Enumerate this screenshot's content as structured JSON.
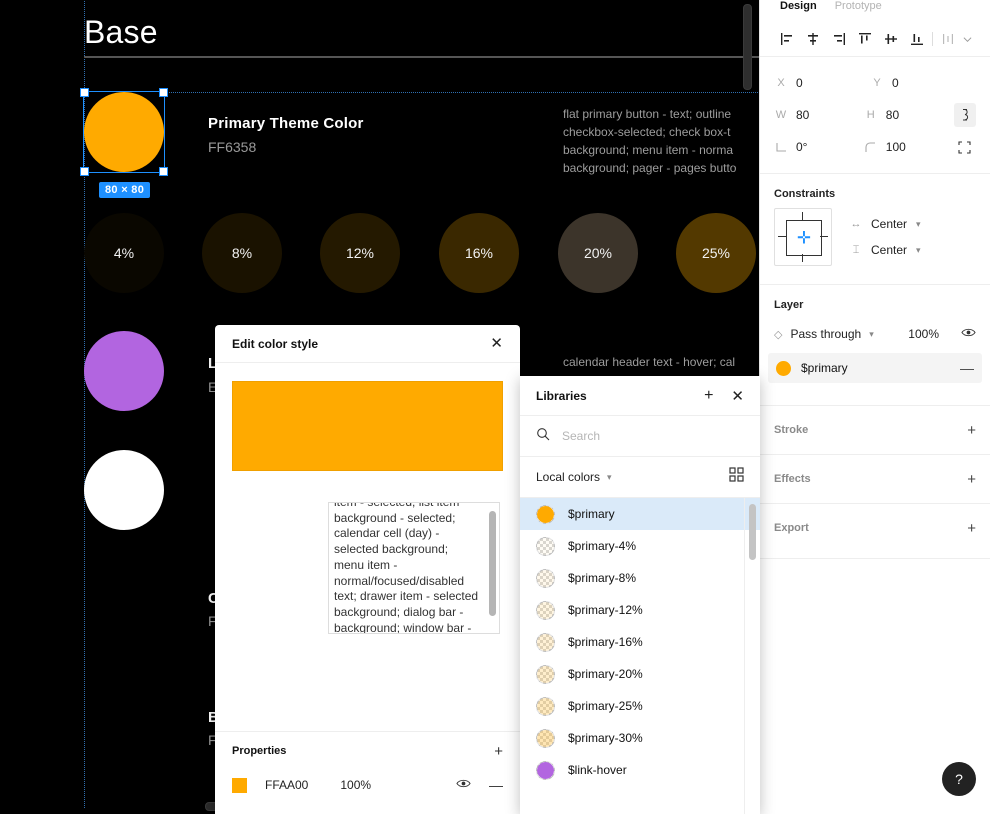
{
  "canvas": {
    "page_title": "Base",
    "selection_badge": "80 × 80",
    "primary": {
      "name": "Primary Theme Color",
      "hex": "FF6358",
      "description": "flat primary button - text; outline\ncheckbox-selected; check box-t\nbackground; menu item - norma\nbackground; pager - pages butto"
    },
    "tints": [
      {
        "label": "4%",
        "color": "#0a0700"
      },
      {
        "label": "8%",
        "color": "#1a1200"
      },
      {
        "label": "12%",
        "color": "#241900"
      },
      {
        "label": "16%",
        "color": "#3a2800"
      },
      {
        "label": "20%",
        "color": "#3c342a"
      },
      {
        "label": "25%",
        "color": "#533900"
      }
    ],
    "link_hover": {
      "color": "#b265e0",
      "title_initial": "L",
      "hex_initial": "E"
    },
    "white_swatch": {
      "color": "#ffffff",
      "title_initial": "C",
      "hex_initial": "F"
    },
    "bottom_group": {
      "title_initial": "B",
      "hex_initial": "F"
    },
    "calendar_note": "calendar header text - hover; cal"
  },
  "right_panel": {
    "tabs": [
      {
        "label": "Design",
        "active": true
      },
      {
        "label": "Prototype",
        "active": false
      }
    ],
    "align_icons": [
      "align-left-icon",
      "align-horizontal-center-icon",
      "align-right-icon",
      "align-top-icon",
      "align-vertical-center-icon",
      "align-bottom-icon",
      "distribute-icon"
    ],
    "transform": {
      "x_label": "X",
      "x_value": "0",
      "y_label": "Y",
      "y_value": "0",
      "w_label": "W",
      "w_value": "80",
      "h_label": "H",
      "h_value": "80",
      "rotation_label": "angle",
      "rotation_value": "0°",
      "corner_label": "corner",
      "corner_value": "100"
    },
    "constraints": {
      "title": "Constraints",
      "horizontal": "Center",
      "vertical": "Center"
    },
    "layer": {
      "title": "Layer",
      "blend_mode": "Pass through",
      "opacity": "100%"
    },
    "fill": {
      "style_name": "$primary",
      "color": "#FFAA00"
    },
    "sections": [
      {
        "title": "Stroke"
      },
      {
        "title": "Effects"
      },
      {
        "title": "Export"
      }
    ]
  },
  "edit_dialog": {
    "title": "Edit color style",
    "preview_color": "#FFAA00",
    "description": "item - selected; list item background - selected; calendar cell (day) - selected background; menu item - normal/focused/disabled text; drawer item - selected background; dialog bar - background; window bar - background; pager - pages button text; pager list - selected background;",
    "properties": {
      "title": "Properties",
      "hex": "FFAA00",
      "opacity": "100%"
    }
  },
  "libraries": {
    "title": "Libraries",
    "search_placeholder": "Search",
    "search_value": "",
    "group_label": "Local colors",
    "items": [
      {
        "label": "$primary",
        "color": "#FFAA00",
        "selected": true
      },
      {
        "label": "$primary-4%",
        "color": "rgba(255,170,0,0.04)",
        "selected": false
      },
      {
        "label": "$primary-8%",
        "color": "rgba(255,170,0,0.08)",
        "selected": false
      },
      {
        "label": "$primary-12%",
        "color": "rgba(255,170,0,0.12)",
        "selected": false
      },
      {
        "label": "$primary-16%",
        "color": "rgba(255,170,0,0.16)",
        "selected": false
      },
      {
        "label": "$primary-20%",
        "color": "rgba(255,170,0,0.20)",
        "selected": false
      },
      {
        "label": "$primary-25%",
        "color": "rgba(255,170,0,0.25)",
        "selected": false
      },
      {
        "label": "$primary-30%",
        "color": "rgba(255,170,0,0.30)",
        "selected": false
      },
      {
        "label": "$link-hover",
        "color": "#b265e0",
        "selected": false
      }
    ]
  },
  "help": {
    "label": "?"
  }
}
